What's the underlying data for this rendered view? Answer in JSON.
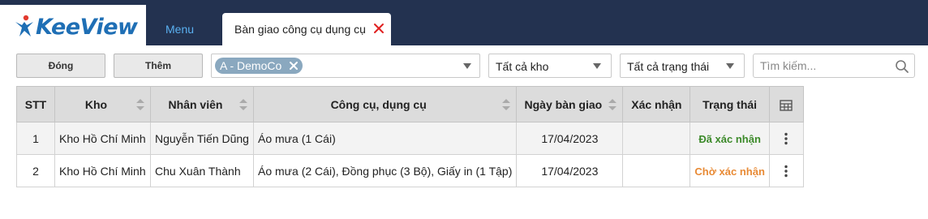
{
  "app": {
    "logo_text": "KeeView"
  },
  "nav": {
    "menu_label": "Menu",
    "tab_label": "Bàn giao công cụ dụng cụ"
  },
  "toolbar": {
    "close_label": "Đóng",
    "add_label": "Thêm",
    "company_chip": "A - DemoCo",
    "warehouse_value": "Tất cả kho",
    "status_value": "Tất cả trạng thái",
    "search_placeholder": "Tìm kiếm..."
  },
  "table": {
    "headers": {
      "stt": "STT",
      "kho": "Kho",
      "nhan_vien": "Nhân viên",
      "cong_cu": "Công cụ, dụng cụ",
      "ngay": "Ngày bàn giao",
      "xac_nhan": "Xác nhận",
      "trang_thai": "Trạng thái"
    },
    "rows": [
      {
        "stt": "1",
        "kho": "Kho Hồ Chí Minh",
        "nhan_vien": "Nguyễn Tiến Dũng",
        "cong_cu": "Áo mưa (1 Cái)",
        "ngay": "17/04/2023",
        "xac_nhan": "",
        "trang_thai": "Đã xác nhận"
      },
      {
        "stt": "2",
        "kho": "Kho Hồ Chí Minh",
        "nhan_vien": "Chu Xuân Thành",
        "cong_cu": "Áo mưa (2 Cái), Đồng phục (3 Bộ), Giấy in (1 Tập)",
        "ngay": "17/04/2023",
        "xac_nhan": "",
        "trang_thai": "Chờ xác nhận"
      }
    ]
  },
  "colors": {
    "navbar": "#233250",
    "menu_link": "#5ab0f0",
    "tab_close": "#e02020",
    "chip": "#8aa8bf",
    "status_confirmed": "#3c8a2a",
    "status_pending": "#e88a35",
    "header_bg": "#dcdcdc"
  },
  "icons": {
    "logo": "keeview-figure-logo",
    "tab_close": "close-icon",
    "chip_remove": "close-icon",
    "dropdown": "caret-down-icon",
    "search": "search-icon",
    "sort": "sort-icon",
    "columns": "table-columns-icon",
    "row_actions": "kebab-menu-icon"
  }
}
